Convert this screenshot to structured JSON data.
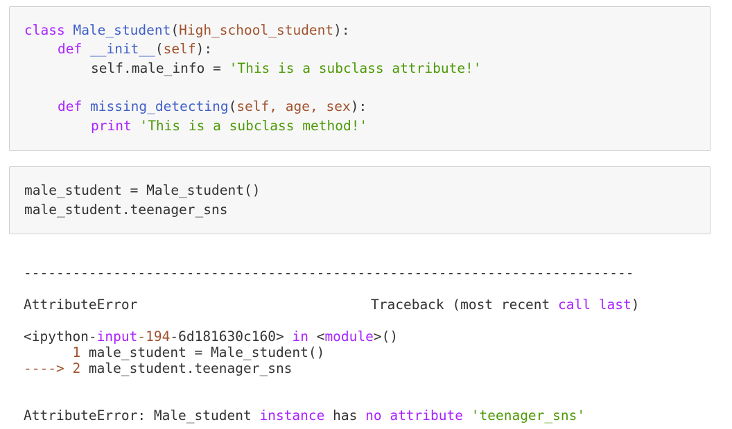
{
  "cell1": {
    "line1": {
      "kw": "class",
      "name": "Male_student",
      "paren_open": "(",
      "base": "High_school_student",
      "paren_close": "):"
    },
    "line2": {
      "kw": "def",
      "name": "__init__",
      "paren_open": "(",
      "arg": "self",
      "paren_close": "):"
    },
    "line3": {
      "target": "self.male_info = ",
      "value": "'This is a subclass attribute!'"
    },
    "line5": {
      "kw": "def",
      "name": "missing_detecting",
      "paren_open": "(",
      "args": "self, age, sex",
      "paren_close": "):"
    },
    "line6": {
      "kw": "print",
      "value": "'This is a subclass method!'"
    }
  },
  "cell2": {
    "line1": "male_student = Male_student()",
    "line2": "male_student.teenager_sns"
  },
  "output": {
    "divider": "---------------------------------------------------------------------------",
    "error_name": "AttributeError",
    "traceback_label_1": "Traceback (most recent ",
    "traceback_label_call": "call",
    "traceback_label_sp": " ",
    "traceback_label_last": "last",
    "traceback_label_close": ")",
    "input_ref_prefix": "<ipython-",
    "input_ref_input": "input",
    "input_ref_dash": "-",
    "input_ref_num": "194",
    "input_ref_rest": "-6d181630c160> ",
    "input_ref_in": "in",
    "input_ref_sp": " <",
    "input_ref_module": "module",
    "input_ref_end": ">()",
    "tb_line1_num": "      1",
    "tb_line1_code": " male_student = Male_student()",
    "tb_line2_arrow": "----> 2",
    "tb_line2_code": " male_student.teenager_sns",
    "final_error_name": "AttributeError: Male_student ",
    "final_instance": "instance",
    "final_has": " has ",
    "final_no": "no",
    "final_sp": " ",
    "final_attribute": "attribute",
    "final_sp2": " ",
    "final_attr_name": "'teenager_sns'"
  },
  "colors": {
    "keyword": "#aa22ff",
    "name": "#4060c8",
    "argument": "#a0522d",
    "string": "#4e9a06",
    "cell_background": "#f7f7f7",
    "cell_border": "#cfcfcf"
  }
}
